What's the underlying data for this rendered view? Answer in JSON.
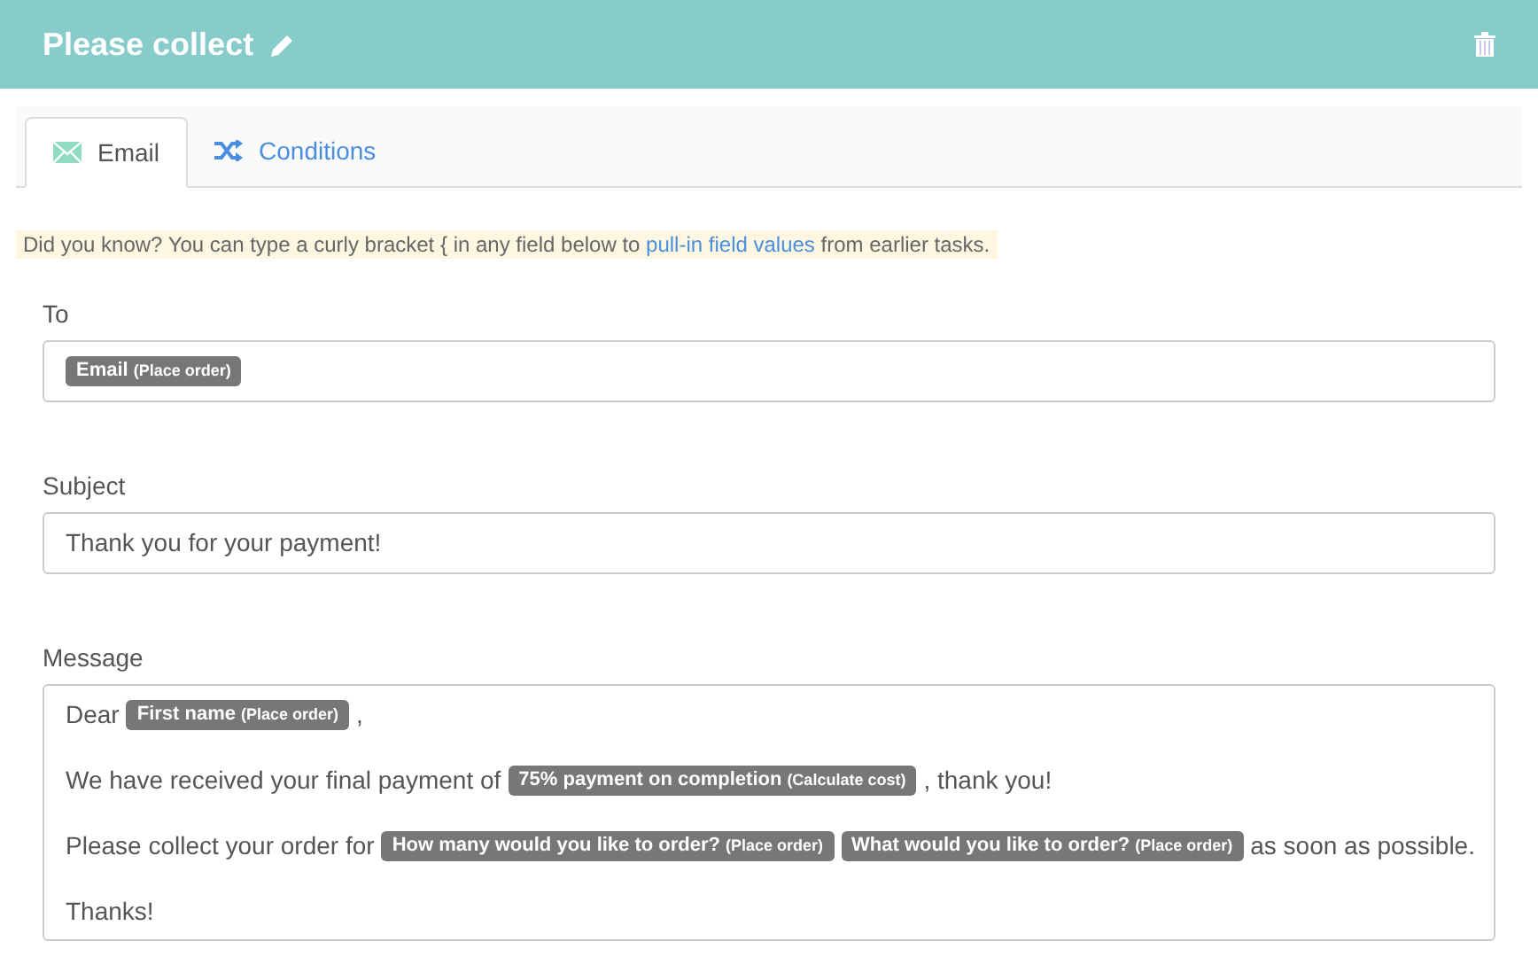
{
  "header": {
    "title": "Please collect"
  },
  "tabs": [
    {
      "label": "Email",
      "kind": "email",
      "selected": true
    },
    {
      "label": "Conditions",
      "kind": "conditions",
      "selected": false
    }
  ],
  "tip": {
    "before": "Did you know? You can type a curly bracket { in any field below to ",
    "link": "pull-in field values",
    "after": " from earlier tasks."
  },
  "to": {
    "label": "To",
    "tokens": [
      {
        "name": "Email",
        "source": "(Place order)"
      }
    ]
  },
  "subject": {
    "label": "Subject",
    "value": "Thank you for your payment!"
  },
  "message": {
    "label": "Message",
    "lines": [
      {
        "parts": [
          {
            "kind": "text",
            "text": "Dear"
          },
          {
            "kind": "token",
            "name": "First name",
            "source": "(Place order)"
          },
          {
            "kind": "text",
            "text": ","
          }
        ]
      },
      {
        "parts": [
          {
            "kind": "text",
            "text": "We have received your final payment of"
          },
          {
            "kind": "token",
            "name": "75% payment on completion",
            "source": "(Calculate cost)"
          },
          {
            "kind": "text",
            "text": ", thank you!"
          }
        ]
      },
      {
        "parts": [
          {
            "kind": "text",
            "text": "Please collect your order for"
          },
          {
            "kind": "token",
            "name": "How many would you like to order?",
            "source": "(Place order)"
          },
          {
            "kind": "token",
            "name": "What would you like to order?",
            "source": "(Place order)"
          },
          {
            "kind": "text",
            "text": "as soon as possible."
          }
        ]
      },
      {
        "parts": [
          {
            "kind": "text",
            "text": "Thanks!"
          }
        ]
      }
    ]
  }
}
